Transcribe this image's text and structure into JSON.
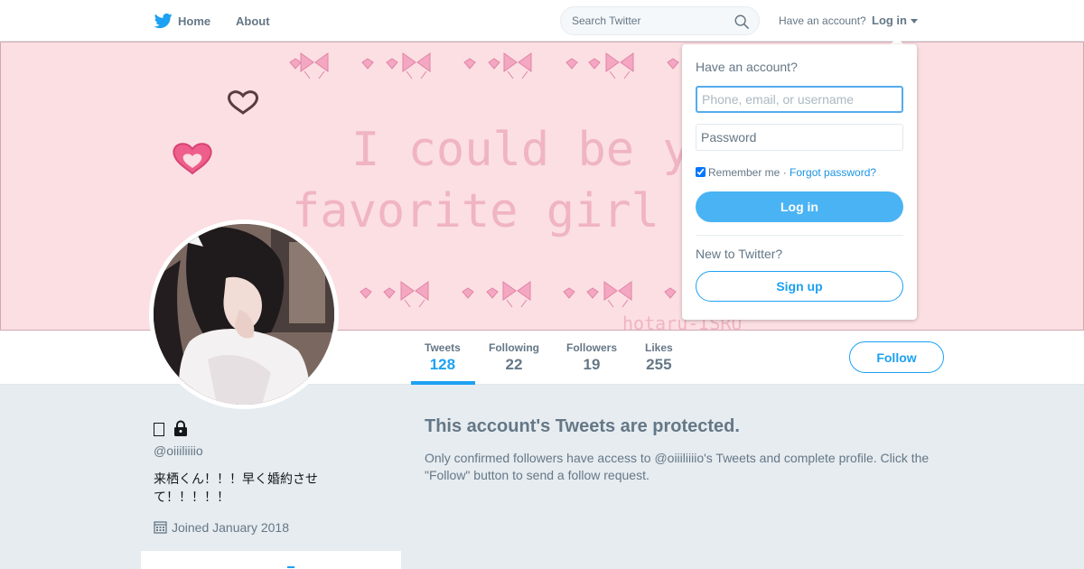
{
  "nav": {
    "home_label": "Home",
    "about_label": "About",
    "search_placeholder": "Search Twitter",
    "have_account": "Have an account?",
    "login_label": "Log in"
  },
  "banner": {
    "line1": "I could be you",
    "line2": "favorite girl fore",
    "signature": "hotaru-ISRU",
    "colors": {
      "background": "#fbdfe3",
      "accent": "#f4a7c1",
      "text": "#f0b4c3"
    }
  },
  "stats": [
    {
      "label": "Tweets",
      "value": "128"
    },
    {
      "label": "Following",
      "value": "22"
    },
    {
      "label": "Followers",
      "value": "19"
    },
    {
      "label": "Likes",
      "value": "255"
    }
  ],
  "follow_label": "Follow",
  "profile": {
    "handle": "@oiiiliiiio",
    "bio": "来栖くん！！！早く婚約させて！！！！！",
    "joined": "Joined January 2018"
  },
  "protected": {
    "title": "This account's Tweets are protected.",
    "text": "Only confirmed followers have access to @oiiiliiiio's Tweets and complete profile. Click the \"Follow\" button to send a follow request."
  },
  "login_dropdown": {
    "title": "Have an account?",
    "username_placeholder": "Phone, email, or username",
    "password_placeholder": "Password",
    "remember_label": "Remember me",
    "separator": " · ",
    "forgot_label": "Forgot password?",
    "login_button": "Log in",
    "new_to": "New to Twitter?",
    "signup_button": "Sign up"
  },
  "colors": {
    "brand": "#1da1f2",
    "login_button": "#4ab3f4",
    "muted": "#657786"
  }
}
